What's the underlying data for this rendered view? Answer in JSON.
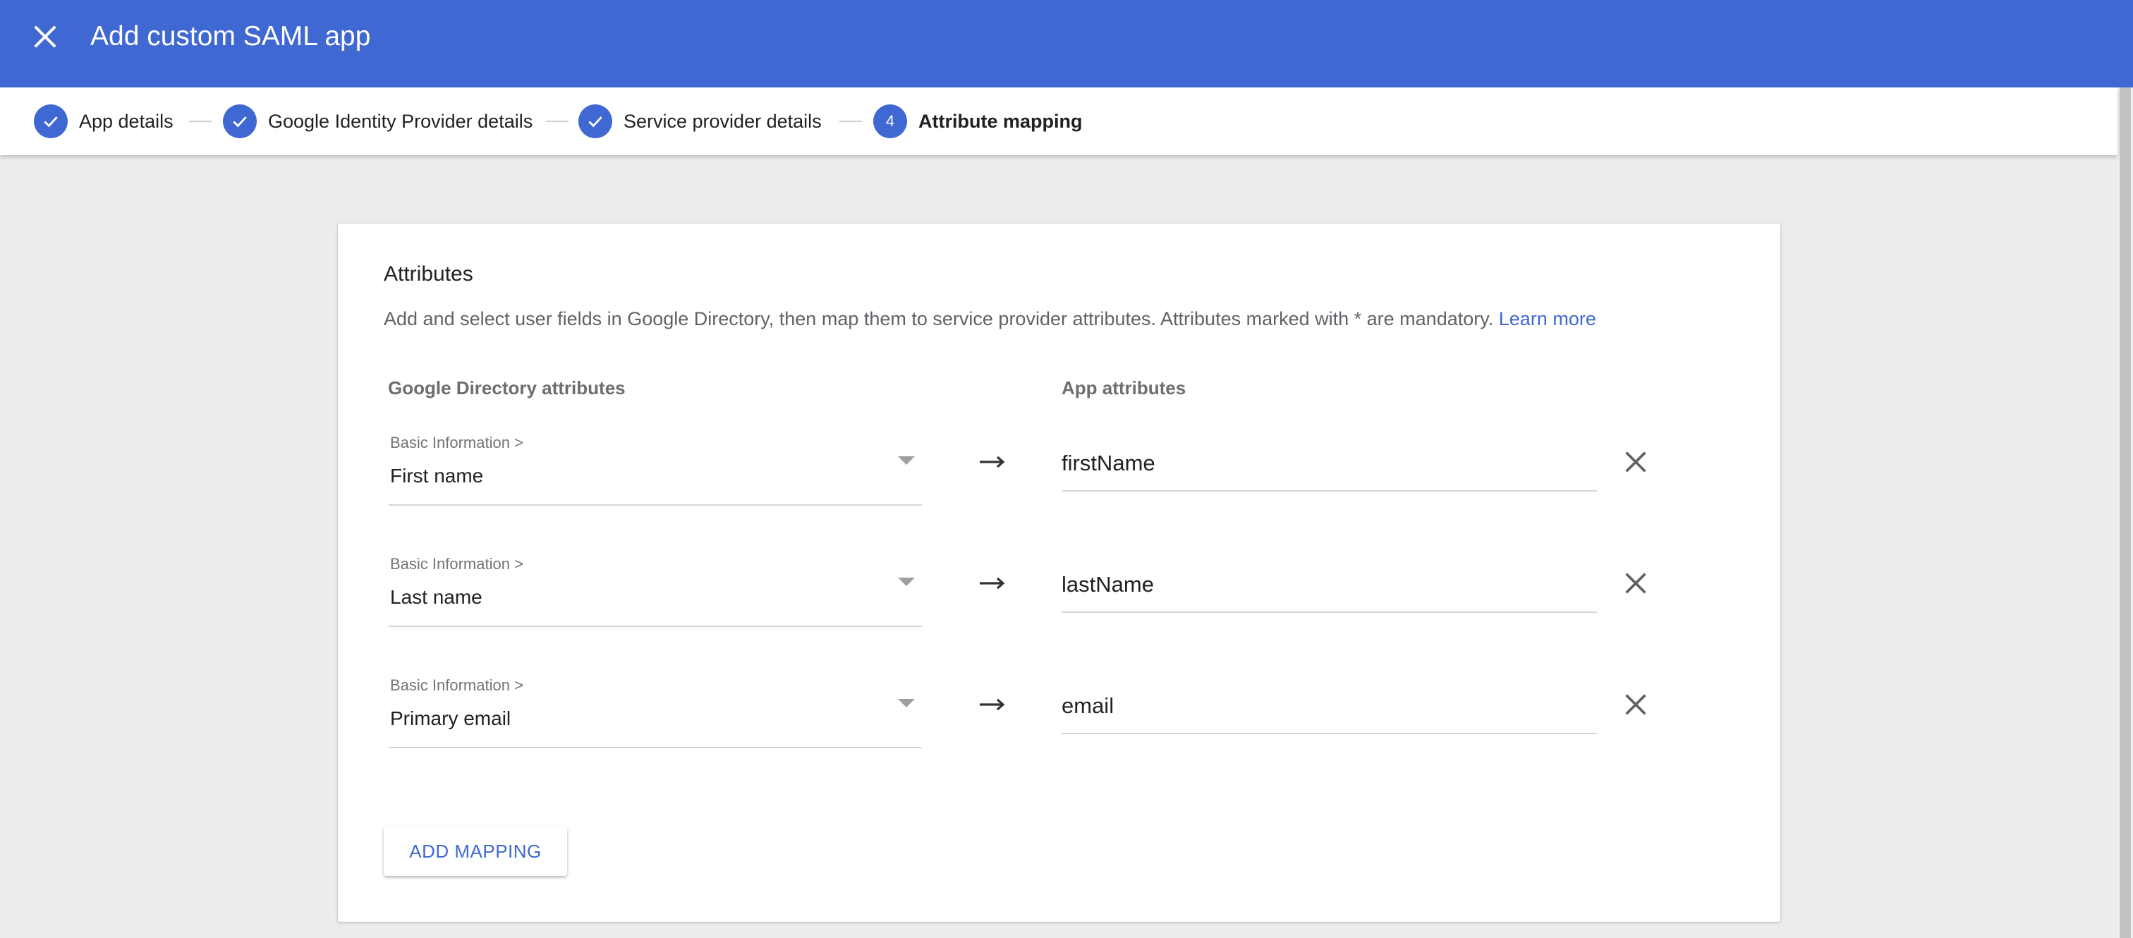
{
  "header": {
    "title": "Add custom SAML app",
    "close_icon": "close-icon",
    "background": "#3f68d2"
  },
  "stepper": {
    "steps": [
      {
        "label": "App details",
        "state": "done"
      },
      {
        "label": "Google Identity Provider details",
        "state": "done"
      },
      {
        "label": "Service provider details",
        "state": "done"
      },
      {
        "label": "Attribute mapping",
        "state": "current",
        "number": "4"
      }
    ]
  },
  "card": {
    "heading": "Attributes",
    "description": "Add and select user fields in Google Directory, then map them to service provider attributes. Attributes marked with * are mandatory.",
    "learn_more": "Learn more",
    "col_google": "Google Directory attributes",
    "col_app": "App attributes",
    "mappings": [
      {
        "category": "Basic Information >",
        "field": "First name",
        "app_attribute": "firstName"
      },
      {
        "category": "Basic Information >",
        "field": "Last name",
        "app_attribute": "lastName"
      },
      {
        "category": "Basic Information >",
        "field": "Primary email",
        "app_attribute": "email"
      }
    ],
    "add_mapping": "ADD MAPPING"
  },
  "colors": {
    "accent": "#3f68d2",
    "page_background": "#ececec"
  }
}
